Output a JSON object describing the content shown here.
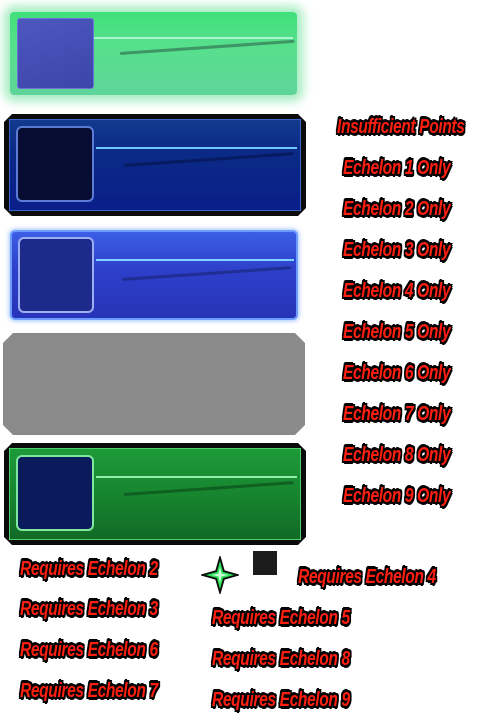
{
  "labels": {
    "insufficient": "Insufficient Points",
    "echelon_only": [
      "Echelon 1 Only",
      "Echelon 2 Only",
      "Echelon 3 Only",
      "Echelon 4 Only",
      "Echelon 5 Only",
      "Echelon 6 Only",
      "Echelon 7 Only",
      "Echelon 8 Only",
      "Echelon 9 Only"
    ],
    "requires": {
      "e2": "Requires Echelon 2",
      "e3": "Requires Echelon 3",
      "e4": "Requires Echelon 4",
      "e5": "Requires Echelon 5",
      "e6": "Requires Echelon 6",
      "e7": "Requires Echelon 7",
      "e8": "Requires Echelon 8",
      "e9": "Requires Echelon 9"
    }
  },
  "icons": {
    "star": "green-four-point-star-icon",
    "square": "dark-square-icon"
  },
  "colors": {
    "label_text": "#ff1f10",
    "label_outline": "#000000",
    "panel_green_glow": "#56e08c",
    "panel_navy": "#0b2a86",
    "panel_blue": "#2d3fc9",
    "panel_gray": "#8a8a8a",
    "panel_green": "#17852f"
  }
}
